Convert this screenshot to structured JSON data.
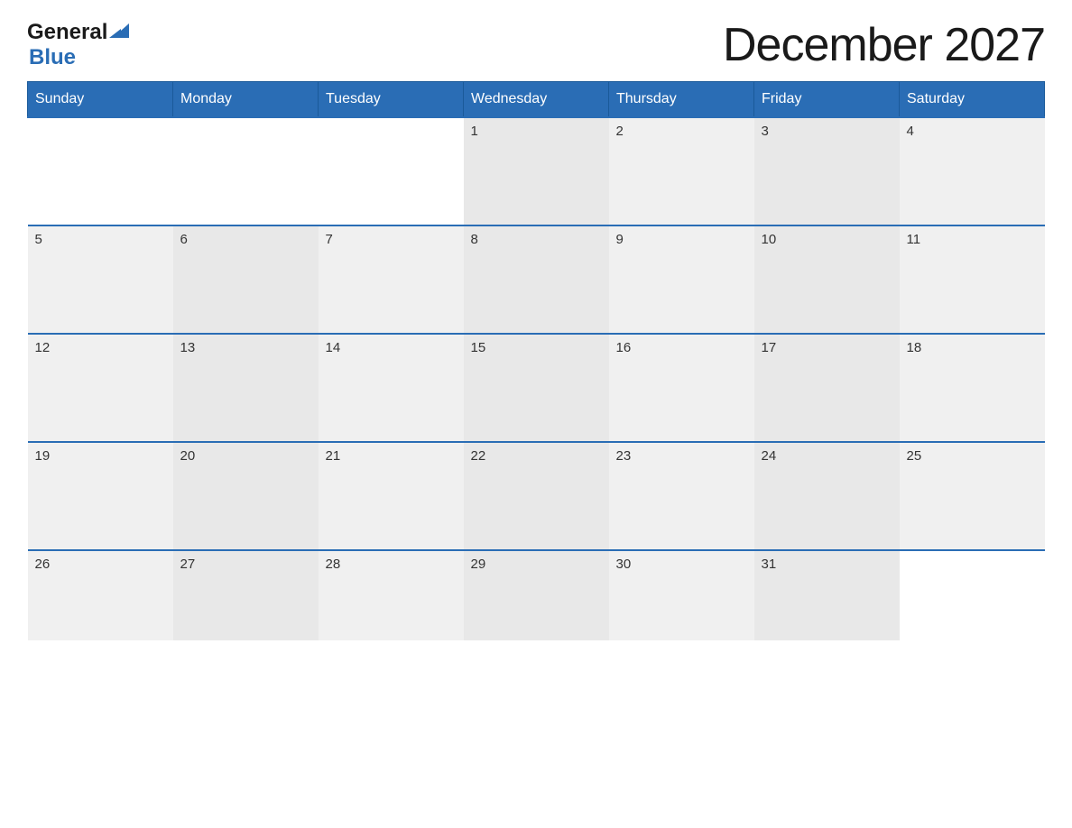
{
  "header": {
    "title": "December 2027",
    "logo": {
      "general": "General",
      "blue": "Blue"
    }
  },
  "calendar": {
    "days_of_week": [
      "Sunday",
      "Monday",
      "Tuesday",
      "Wednesday",
      "Thursday",
      "Friday",
      "Saturday"
    ],
    "weeks": [
      [
        {
          "date": "",
          "empty": true
        },
        {
          "date": "",
          "empty": true
        },
        {
          "date": "",
          "empty": true
        },
        {
          "date": "1",
          "empty": false
        },
        {
          "date": "2",
          "empty": false
        },
        {
          "date": "3",
          "empty": false
        },
        {
          "date": "4",
          "empty": false
        }
      ],
      [
        {
          "date": "5",
          "empty": false
        },
        {
          "date": "6",
          "empty": false
        },
        {
          "date": "7",
          "empty": false
        },
        {
          "date": "8",
          "empty": false
        },
        {
          "date": "9",
          "empty": false
        },
        {
          "date": "10",
          "empty": false
        },
        {
          "date": "11",
          "empty": false
        }
      ],
      [
        {
          "date": "12",
          "empty": false
        },
        {
          "date": "13",
          "empty": false
        },
        {
          "date": "14",
          "empty": false
        },
        {
          "date": "15",
          "empty": false
        },
        {
          "date": "16",
          "empty": false
        },
        {
          "date": "17",
          "empty": false
        },
        {
          "date": "18",
          "empty": false
        }
      ],
      [
        {
          "date": "19",
          "empty": false
        },
        {
          "date": "20",
          "empty": false
        },
        {
          "date": "21",
          "empty": false
        },
        {
          "date": "22",
          "empty": false
        },
        {
          "date": "23",
          "empty": false
        },
        {
          "date": "24",
          "empty": false
        },
        {
          "date": "25",
          "empty": false
        }
      ],
      [
        {
          "date": "26",
          "empty": false
        },
        {
          "date": "27",
          "empty": false
        },
        {
          "date": "28",
          "empty": false
        },
        {
          "date": "29",
          "empty": false
        },
        {
          "date": "30",
          "empty": false
        },
        {
          "date": "31",
          "empty": false
        },
        {
          "date": "",
          "empty": true
        }
      ]
    ]
  },
  "colors": {
    "header_bg": "#2a6db5",
    "header_text": "#ffffff",
    "cell_bg_odd": "#f5f5f5",
    "cell_bg_even": "#eeeeee",
    "cell_empty_bg": "#ffffff",
    "border": "#2a6db5"
  }
}
